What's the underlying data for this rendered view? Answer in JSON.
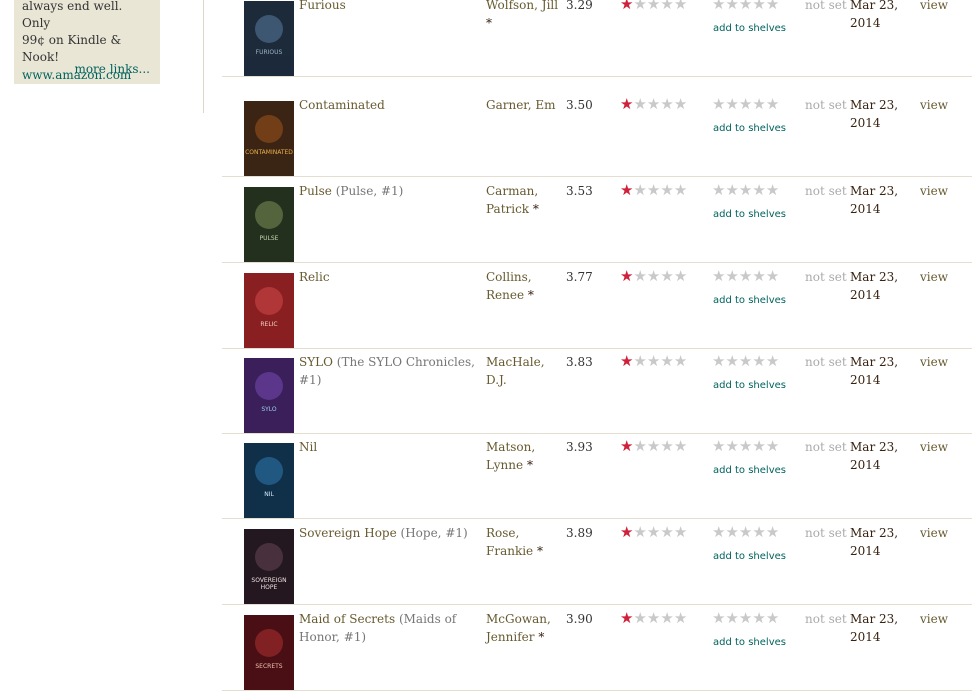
{
  "sidebar": {
    "promo_line1": "always end well. Only",
    "promo_line2": "99¢ on Kindle & Nook!",
    "site_link": "www.amazon.com",
    "more_links": "more links..."
  },
  "columns": {
    "not_set": "not set",
    "add_to_shelves": "add to shelves",
    "view": "view"
  },
  "colors": {
    "accent_red": "#d0213a",
    "link_brown": "#675a30",
    "link_green": "#00635d"
  },
  "books": [
    {
      "title": "Furious",
      "series": "",
      "author": "Wolfson, Jill",
      "author_star": "*",
      "avg": "3.29",
      "rating": 1,
      "date_line1": "Mar 23,",
      "date_line2": "2014",
      "cover_text": "FURIOUS"
    },
    {
      "title": "Contaminated",
      "series": "",
      "author": "Garner, Em",
      "author_star": "",
      "avg": "3.50",
      "rating": 1,
      "date_line1": "Mar 23,",
      "date_line2": "2014",
      "cover_text": "CONTAMINATED"
    },
    {
      "title": "Pulse",
      "series": "(Pulse, #1)",
      "author": "Carman, Patrick",
      "author_star": "*",
      "avg": "3.53",
      "rating": 1,
      "date_line1": "Mar 23,",
      "date_line2": "2014",
      "cover_text": "PULSE"
    },
    {
      "title": "Relic",
      "series": "",
      "author": "Collins, Renee",
      "author_star": "*",
      "avg": "3.77",
      "rating": 1,
      "date_line1": "Mar 23,",
      "date_line2": "2014",
      "cover_text": "RELIC"
    },
    {
      "title": "SYLO",
      "series": "(The SYLO Chronicles, #1)",
      "author": "MacHale, D.J.",
      "author_star": "",
      "avg": "3.83",
      "rating": 1,
      "date_line1": "Mar 23,",
      "date_line2": "2014",
      "cover_text": "SYLO"
    },
    {
      "title": "Nil",
      "series": "",
      "author": "Matson, Lynne",
      "author_star": "*",
      "avg": "3.93",
      "rating": 1,
      "date_line1": "Mar 23,",
      "date_line2": "2014",
      "cover_text": "NIL"
    },
    {
      "title": "Sovereign Hope",
      "series": "(Hope, #1)",
      "author": "Rose, Frankie",
      "author_star": "*",
      "avg": "3.89",
      "rating": 1,
      "date_line1": "Mar 23,",
      "date_line2": "2014",
      "cover_text": "SOVEREIGN HOPE"
    },
    {
      "title": "Maid of Secrets",
      "series": "(Maids of Honor, #1)",
      "author": "McGowan, Jennifer",
      "author_star": "*",
      "avg": "3.90",
      "rating": 1,
      "date_line1": "Mar 23,",
      "date_line2": "2014",
      "cover_text": "SECRETS"
    }
  ]
}
